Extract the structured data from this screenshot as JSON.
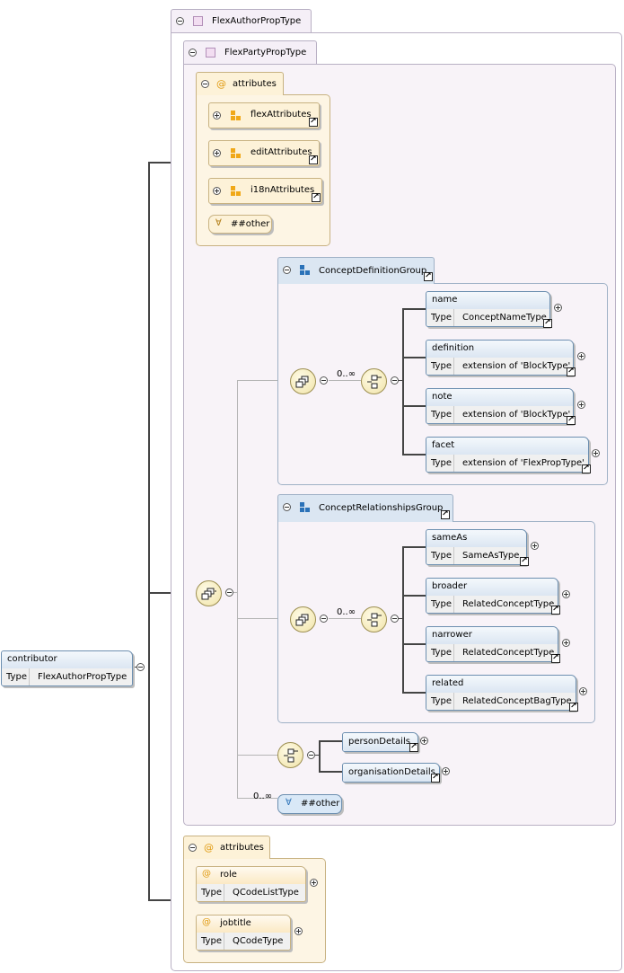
{
  "root": {
    "name": "contributor",
    "type_label": "Type",
    "type_value": "FlexAuthorPropType"
  },
  "outer_type": {
    "label": "FlexAuthorPropType"
  },
  "inner_type": {
    "label": "FlexPartyPropType"
  },
  "attributes_top": {
    "label": "attributes",
    "groups": [
      {
        "name": "flexAttributes"
      },
      {
        "name": "editAttributes"
      },
      {
        "name": "i18nAttributes"
      }
    ],
    "any_label": "##other"
  },
  "concept_definition_group": {
    "label": "ConceptDefinitionGroup",
    "occurrence": "0..∞",
    "elements": [
      {
        "name": "name",
        "type_label": "Type",
        "type_value": "ConceptNameType"
      },
      {
        "name": "definition",
        "type_label": "Type",
        "type_value": "extension of 'BlockType'"
      },
      {
        "name": "note",
        "type_label": "Type",
        "type_value": "extension of 'BlockType'"
      },
      {
        "name": "facet",
        "type_label": "Type",
        "type_value": "extension of 'FlexPropType'"
      }
    ]
  },
  "concept_relationships_group": {
    "label": "ConceptRelationshipsGroup",
    "occurrence": "0..∞",
    "elements": [
      {
        "name": "sameAs",
        "type_label": "Type",
        "type_value": "SameAsType"
      },
      {
        "name": "broader",
        "type_label": "Type",
        "type_value": "RelatedConceptType"
      },
      {
        "name": "narrower",
        "type_label": "Type",
        "type_value": "RelatedConceptType"
      },
      {
        "name": "related",
        "type_label": "Type",
        "type_value": "RelatedConceptBagType"
      }
    ]
  },
  "choice_details": {
    "elements": [
      {
        "name": "personDetails"
      },
      {
        "name": "organisationDetails"
      }
    ]
  },
  "any_bottom": {
    "occurrence": "0..∞",
    "label": "##other"
  },
  "attributes_bottom": {
    "label": "attributes",
    "attrs": [
      {
        "name": "role",
        "type_label": "Type",
        "type_value": "QCodeListType"
      },
      {
        "name": "jobtitle",
        "type_label": "Type",
        "type_value": "QCodeType"
      }
    ]
  },
  "colors": {
    "element_border": "#6d8fb0",
    "group_bg": "#fdf2d8",
    "type_panel_bg": "#f8f3f8",
    "compositor_bg": "#f0e3a8"
  }
}
